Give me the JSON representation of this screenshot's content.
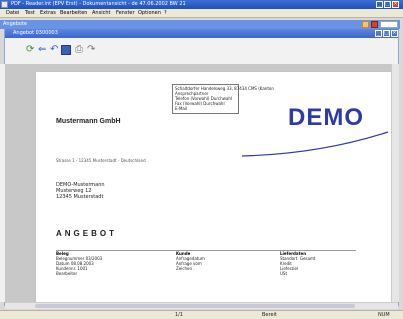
{
  "titlebar": {
    "title": "PDF - Reader.int (EPV Erst) - Dokumentansicht - de 47.06.2002 BW 21"
  },
  "menubar": {
    "items": [
      "Datei",
      "Test",
      "Extras",
      "Bearbeiten",
      "Ansicht",
      "Fenster",
      "Optionen",
      "?"
    ]
  },
  "mdi": {
    "title": "Angebote"
  },
  "inner": {
    "title": "Angebot 0300003"
  },
  "page": {
    "infobox": [
      "Schaltdorfer Handelsweg 33, 87434 CMS (Kanton",
      "Ansprechpartner",
      "Telefon (Vorwahl) Durchwahl",
      "Fax (Vorwahl) Durchwahl",
      "E-Mail"
    ],
    "logo": "DEMO",
    "company": "Mustermann GmbH",
    "sender_line": "Strasse 1 - 12345 Musterstadt - Deutschland",
    "recipient": [
      "DEMO-Mustermann",
      "Musterweg 12",
      "12345 Musterstadt"
    ],
    "doc_title": "ANGEBOT",
    "table": {
      "col1": {
        "header": "Beleg",
        "rows": [
          [
            "Belegnummer",
            "03/2003"
          ],
          [
            "Datum",
            "08.08.2003"
          ],
          [
            "Kundennr.",
            "1001"
          ],
          [
            "Bearbeiter",
            ""
          ]
        ]
      },
      "col2": {
        "header": "Kunde",
        "rows": [
          "Anfragedatum",
          "Anfrage vom",
          "Zeichen"
        ]
      },
      "col3": {
        "header": "Lieferdaten",
        "rows": [
          [
            "Standort",
            "Gesamt"
          ],
          [
            "Kredit",
            ""
          ],
          [
            "Lieferziel",
            ""
          ],
          [
            "USt",
            ""
          ]
        ]
      }
    }
  },
  "statusbar": {
    "left": "",
    "middle": "1/1",
    "page": "Bereit",
    "right": "NUM"
  },
  "colors": {
    "title_blue": "#1f4fb8",
    "logo_blue": "#2d3aa8"
  },
  "icons": [
    "save-icon",
    "undo-icon",
    "redo-icon",
    "print-icon",
    "refresh-icon",
    "back-icon"
  ]
}
